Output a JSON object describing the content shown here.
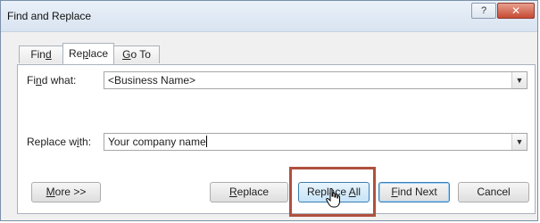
{
  "window": {
    "title": "Find and Replace",
    "help_label": "?",
    "close_label": "✕"
  },
  "tabs": [
    {
      "label": "Find",
      "mnemonic": "d"
    },
    {
      "label": "Replace",
      "mnemonic": "p"
    },
    {
      "label": "Go To",
      "mnemonic": "G"
    }
  ],
  "find": {
    "label": "Find what:",
    "value": "<Business Name>"
  },
  "replace": {
    "label": "Replace with:",
    "value": "Your company name"
  },
  "buttons": {
    "more": "More >>",
    "replace": "Replace",
    "replace_all": "Replace All",
    "find_next": "Find Next",
    "cancel": "Cancel"
  },
  "colors": {
    "highlight": "#b0503e",
    "close_button": "#c74a32",
    "focus_border": "#3c7fb1"
  }
}
